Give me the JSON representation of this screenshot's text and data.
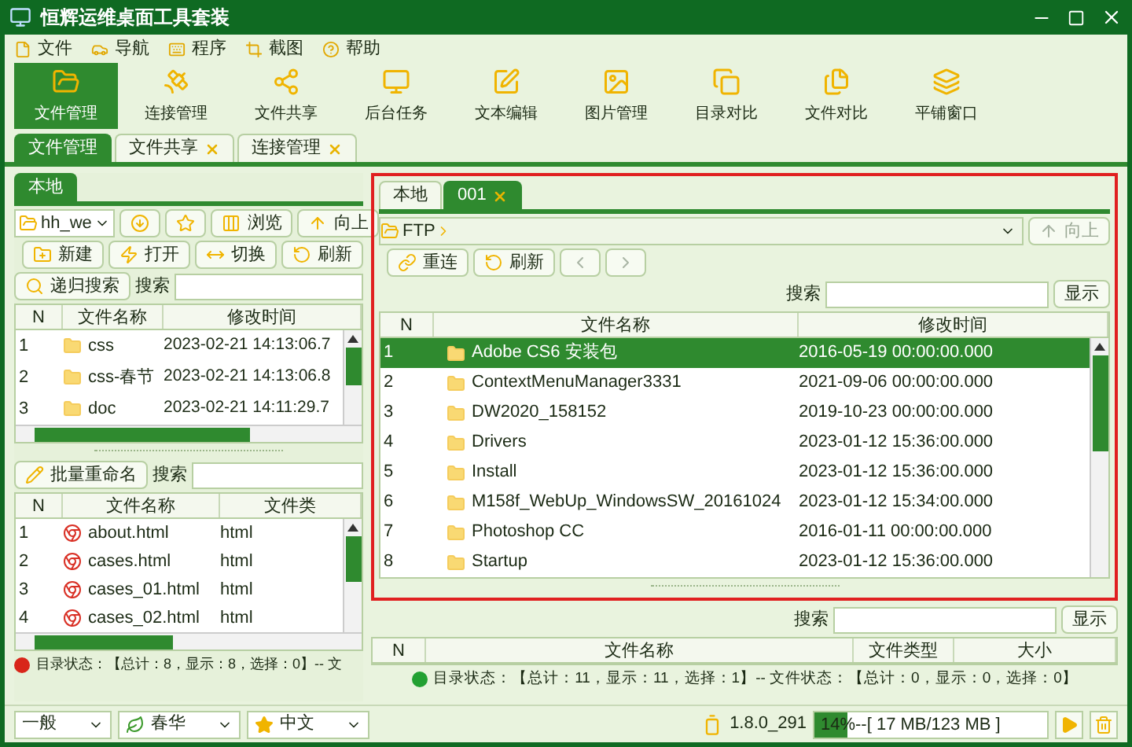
{
  "window": {
    "title": "恒辉运维桌面工具套装"
  },
  "menu": [
    "文件",
    "导航",
    "程序",
    "截图",
    "帮助"
  ],
  "toolbar": [
    {
      "label": "文件管理",
      "selected": true
    },
    {
      "label": "连接管理",
      "selected": false
    },
    {
      "label": "文件共享",
      "selected": false
    },
    {
      "label": "后台任务",
      "selected": false
    },
    {
      "label": "文本编辑",
      "selected": false
    },
    {
      "label": "图片管理",
      "selected": false
    },
    {
      "label": "目录对比",
      "selected": false
    },
    {
      "label": "文件对比",
      "selected": false
    },
    {
      "label": "平铺窗口",
      "selected": false
    }
  ],
  "tabs": [
    {
      "label": "文件管理",
      "selected": true,
      "closable": false
    },
    {
      "label": "文件共享",
      "selected": false,
      "closable": true
    },
    {
      "label": "连接管理",
      "selected": false,
      "closable": true
    }
  ],
  "left_panel": {
    "tabs": [
      {
        "label": "本地",
        "selected": true
      }
    ],
    "path": "hh_we",
    "nav_buttons": [
      "浏览",
      "向上"
    ],
    "actions": [
      "新建",
      "打开",
      "切换",
      "刷新"
    ],
    "recursive_search": "递归搜索",
    "search_label": "搜索",
    "files": {
      "columns": [
        "N",
        "文件名称",
        "修改时间"
      ],
      "rows": [
        {
          "n": "1",
          "name": "css",
          "modified": "2023-02-21 14:13:06.7"
        },
        {
          "n": "2",
          "name": "css-春节",
          "modified": "2023-02-21 14:13:06.8"
        },
        {
          "n": "3",
          "name": "doc",
          "modified": "2023-02-21 14:11:29.7"
        }
      ]
    },
    "rename_button": "批量重命名",
    "search_label_2": "搜索",
    "list": {
      "columns": [
        "N",
        "文件名称",
        "文件类"
      ],
      "rows": [
        {
          "n": "1",
          "name": "about.html",
          "type": "html"
        },
        {
          "n": "2",
          "name": "cases.html",
          "type": "html"
        },
        {
          "n": "3",
          "name": "cases_01.html",
          "type": "html"
        },
        {
          "n": "4",
          "name": "cases_02.html",
          "type": "html"
        }
      ]
    },
    "status": {
      "text": "目录状态：【总计：8，显示：8，选择：0】-- 文",
      "color": "#d8261a"
    }
  },
  "right_panel": {
    "tabs": [
      {
        "label": "本地",
        "selected": false,
        "closable": false
      },
      {
        "label": "001",
        "selected": true,
        "closable": true
      }
    ],
    "path": "FTP",
    "up_button": {
      "label": "向上",
      "disabled": true
    },
    "actions": [
      "重连",
      "刷新"
    ],
    "search_label": "搜索",
    "show_button": "显示",
    "files": {
      "columns": [
        "N",
        "文件名称",
        "修改时间"
      ],
      "rows": [
        {
          "n": "1",
          "name": "Adobe CS6 安装包",
          "modified": "2016-05-19 00:00:00.000",
          "selected": true
        },
        {
          "n": "2",
          "name": "ContextMenuManager3331",
          "modified": "2021-09-06 00:00:00.000",
          "selected": false
        },
        {
          "n": "3",
          "name": "DW2020_158152",
          "modified": "2019-10-23 00:00:00.000",
          "selected": false
        },
        {
          "n": "4",
          "name": "Drivers",
          "modified": "2023-01-12 15:36:00.000",
          "selected": false
        },
        {
          "n": "5",
          "name": "Install",
          "modified": "2023-01-12 15:36:00.000",
          "selected": false
        },
        {
          "n": "6",
          "name": "M158f_WebUp_WindowsSW_20161024",
          "modified": "2023-01-12 15:34:00.000",
          "selected": false
        },
        {
          "n": "7",
          "name": "Photoshop CC",
          "modified": "2016-01-11 00:00:00.000",
          "selected": false
        },
        {
          "n": "8",
          "name": "Startup",
          "modified": "2023-01-12 15:36:00.000",
          "selected": false
        }
      ]
    },
    "search_label_2": "搜索",
    "show_button_2": "显示",
    "list": {
      "columns": [
        "N",
        "文件名称",
        "文件类型",
        "大小"
      ]
    },
    "status": {
      "text": "目录状态：【总计：11，显示：11，选择：1】-- 文件状态：【总计：0，显示：0，选择：0】",
      "color": "#22a032"
    }
  },
  "footer": {
    "dropdowns": [
      "一般",
      "春华",
      "中文"
    ],
    "version": "1.8.0_291",
    "progress": {
      "level": 0.14,
      "reading": "14%--[ 17 MB/123 MB ]"
    }
  }
}
